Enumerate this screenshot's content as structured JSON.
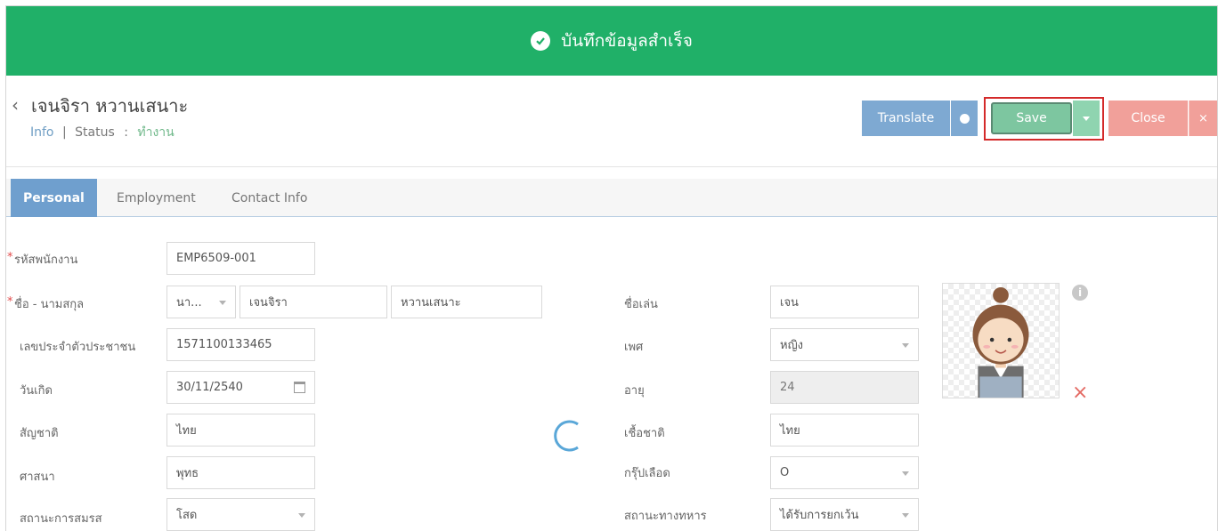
{
  "banner": {
    "message": "บันทึกข้อมูลสำเร็จ",
    "icon": "check-circle-icon",
    "color": "#20b068"
  },
  "header": {
    "employee_name": "เจนจิรา หวานเสนาะ",
    "info_link": "Info",
    "separator": "|",
    "status_label": "Status",
    "status_colon": ":",
    "status_value": "ทำงาน"
  },
  "toolbar": {
    "translate_label": "Translate",
    "save_label": "Save",
    "close_label": "Close",
    "close_x": "×",
    "translate_color": "#7ea9d2",
    "save_color": "#7dc6a0",
    "close_color": "#f1a09a",
    "highlight_color": "#d42a2a"
  },
  "tabs": [
    {
      "label": "Personal",
      "active": true
    },
    {
      "label": "Employment",
      "active": false
    },
    {
      "label": "Contact Info",
      "active": false
    }
  ],
  "form": {
    "employee_id": {
      "label": "รหัสพนักงาน",
      "required": true,
      "value": "EMP6509-001"
    },
    "full_name": {
      "label": "ชื่อ - นามสกุล",
      "required": true,
      "prefix": "นา...",
      "first_name": "เจนจิรา",
      "last_name": "หวานเสนาะ"
    },
    "national_id": {
      "label": "เลขประจำตัวประชาชน",
      "value": "1571100133465"
    },
    "birth_date": {
      "label": "วันเกิด",
      "value": "30/11/2540"
    },
    "nationality": {
      "label": "สัญชาติ",
      "value": "ไทย"
    },
    "religion": {
      "label": "ศาสนา",
      "value": "พุทธ"
    },
    "marital_status": {
      "label": "สถานะการสมรส",
      "value": "โสด"
    },
    "nickname": {
      "label": "ชื่อเล่น",
      "value": "เจน"
    },
    "gender": {
      "label": "เพศ",
      "value": "หญิง"
    },
    "age": {
      "label": "อายุ",
      "value": "24"
    },
    "ethnicity": {
      "label": "เชื้อชาติ",
      "value": "ไทย"
    },
    "blood_group": {
      "label": "กรุ๊ปเลือด",
      "value": "O"
    },
    "military_status": {
      "label": "สถานะทางทหาร",
      "value": "ได้รับการยกเว้น"
    }
  },
  "avatar": {
    "info_icon": "i",
    "remove_icon": "×"
  }
}
